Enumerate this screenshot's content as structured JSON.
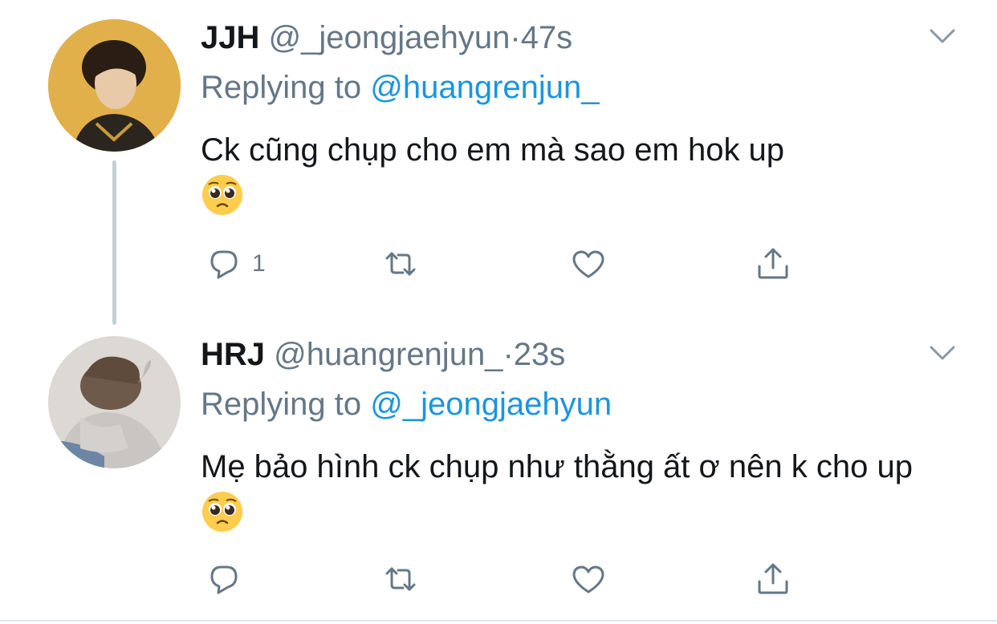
{
  "tweets": [
    {
      "display_name": "JJH",
      "handle": "@_jeongjaehyun",
      "separator": "·",
      "time": "47s",
      "replying_prefix": "Replying to",
      "replying_handle": "@huangrenjun_",
      "text": "Ck cũng chụp cho em mà sao em hok up",
      "emoji": "pleading-face-icon",
      "reply_count": "1",
      "retweet_count": "",
      "like_count": ""
    },
    {
      "display_name": "HRJ",
      "handle": "@huangrenjun_",
      "separator": "·",
      "time": "23s",
      "replying_prefix": "Replying to",
      "replying_handle": "@_jeongjaehyun",
      "text": "Mẹ bảo hình ck chụp như thằng ất ơ nên k cho up",
      "emoji": "pleading-face-icon",
      "reply_count": "",
      "retweet_count": "",
      "like_count": ""
    }
  ],
  "colors": {
    "text": "#14171a",
    "secondary": "#657786",
    "link": "#1b95e0",
    "thread_line": "#c4cfd6"
  }
}
